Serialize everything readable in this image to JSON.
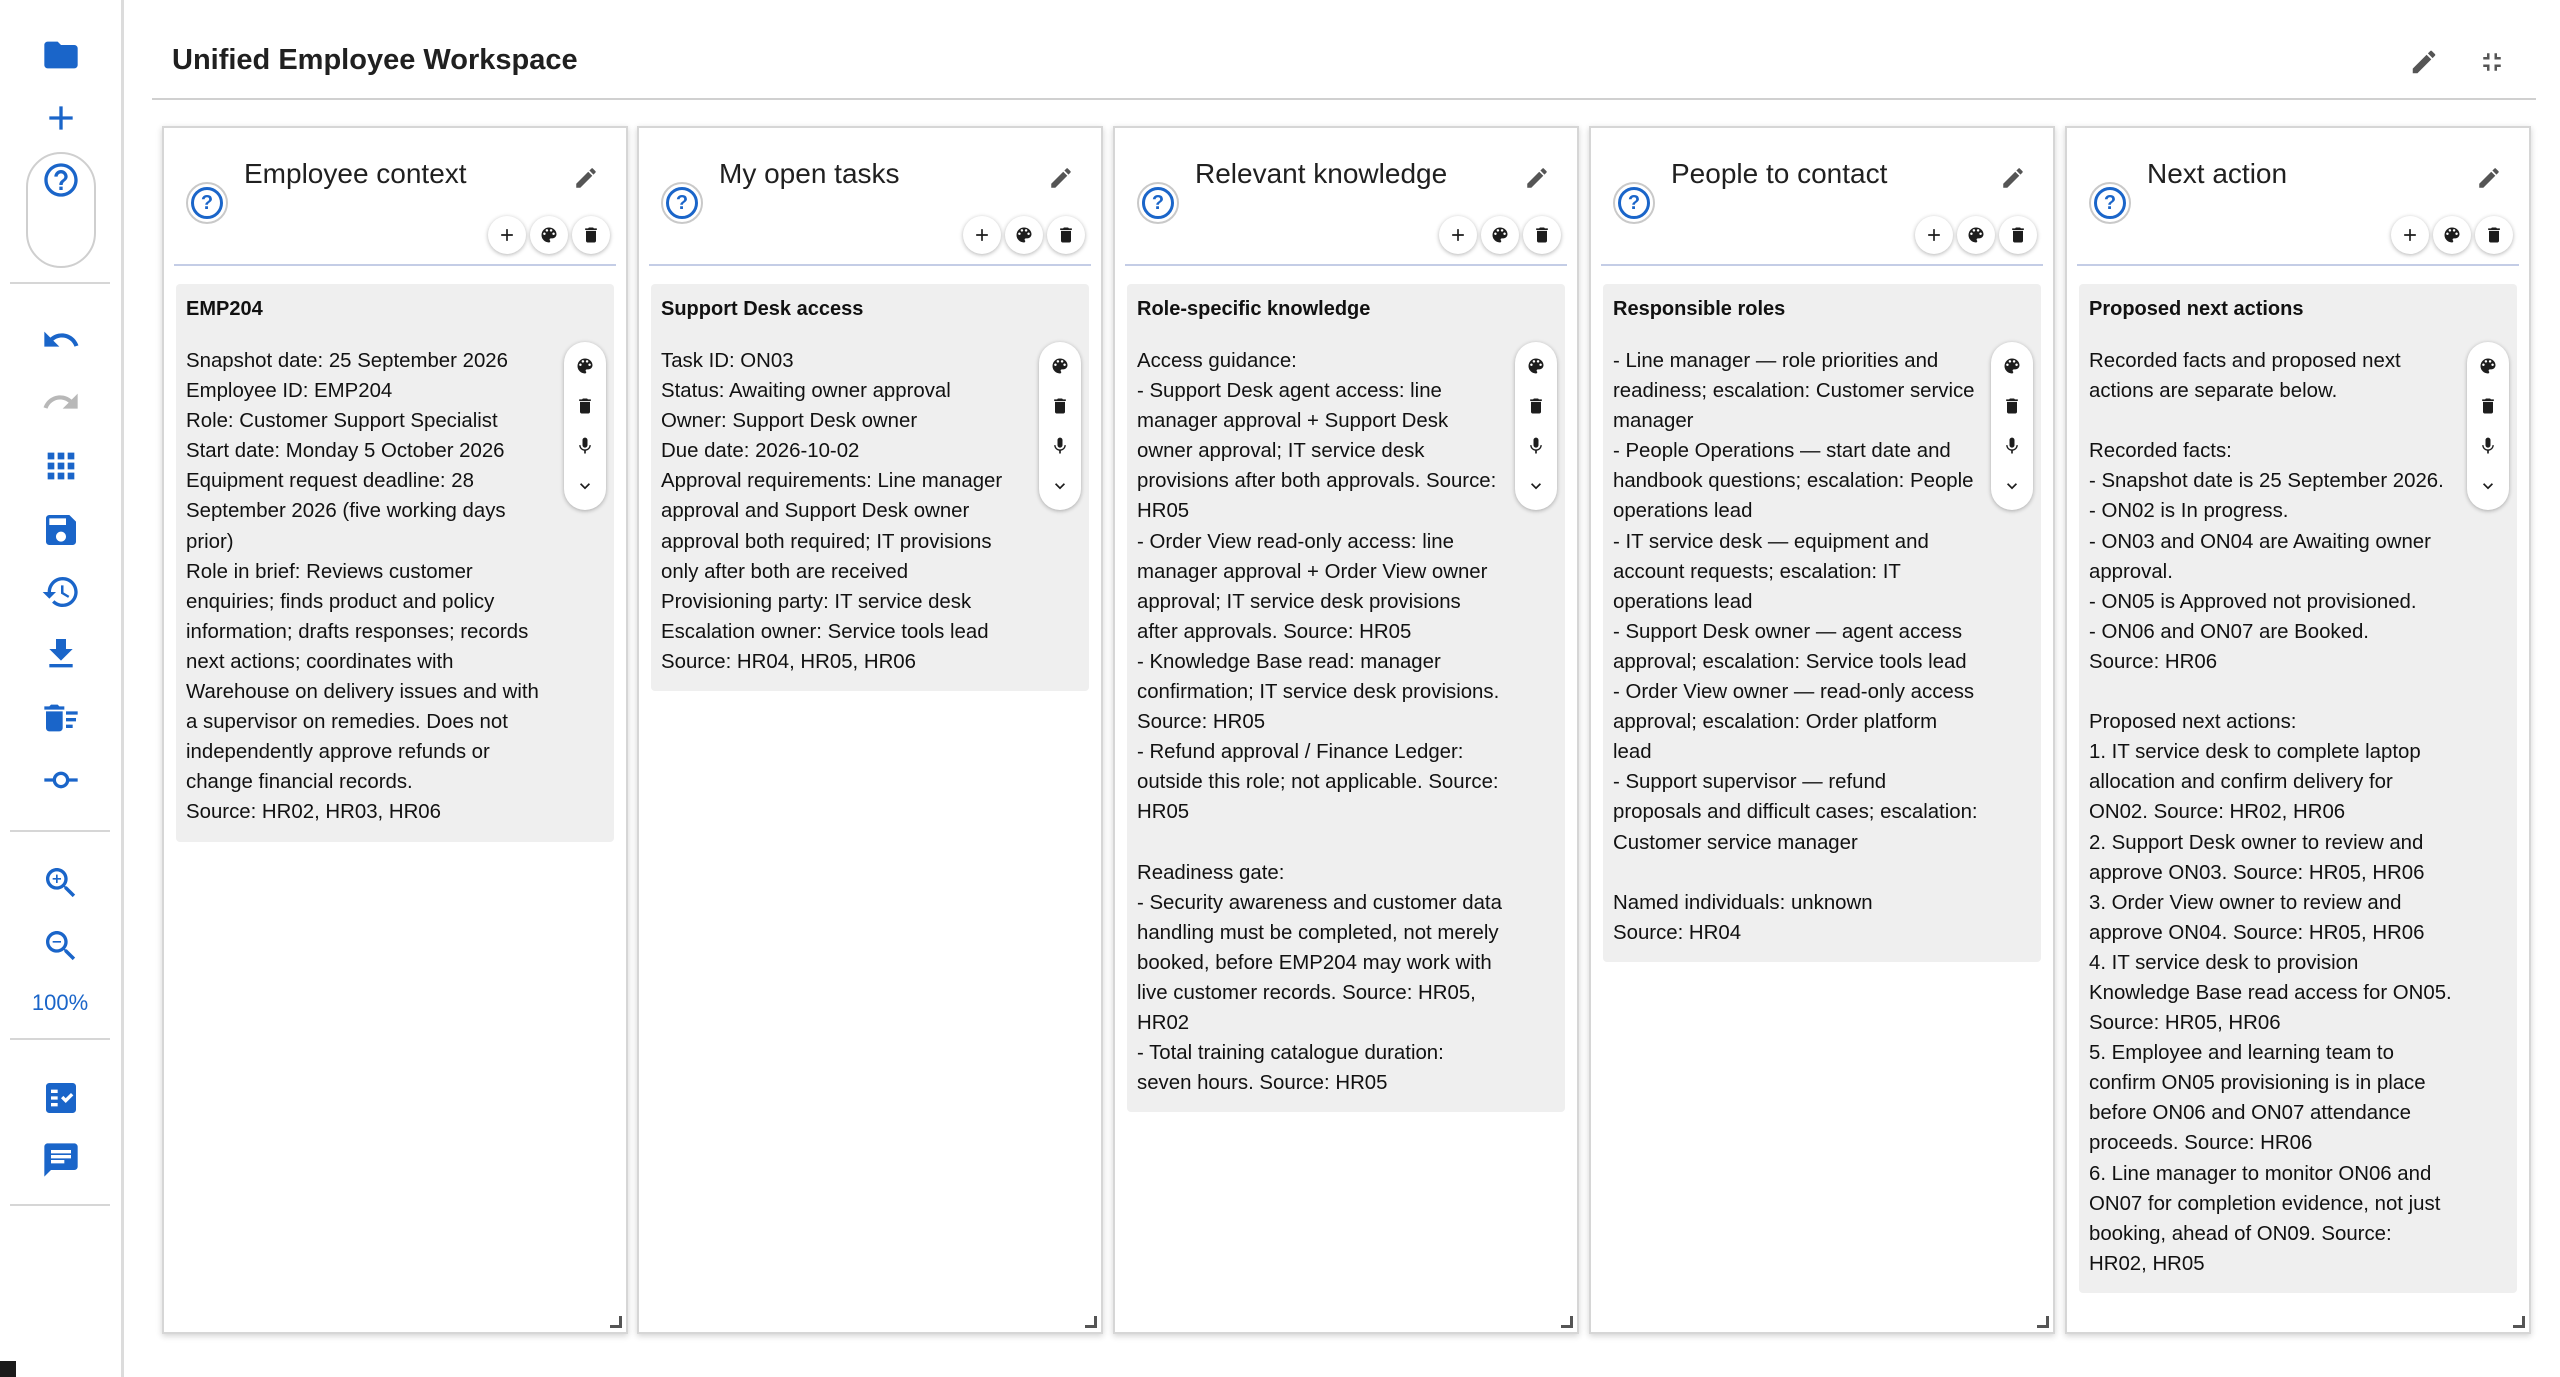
{
  "workspace": {
    "title": "Unified Employee Workspace",
    "edit_icon": "pencil-icon",
    "collapse_icon": "collapse-icon"
  },
  "toolbar": {
    "zoom_label": "100%",
    "icons": [
      "folder-icon",
      "plus-icon",
      "help-icon",
      "undo-icon",
      "redo-icon",
      "grid-icon",
      "save-icon",
      "history-icon",
      "download-icon",
      "delete-list-icon",
      "commit-icon",
      "zoom-in-icon",
      "zoom-out-icon",
      "checklist-icon",
      "chat-icon"
    ]
  },
  "panels": [
    {
      "title": "Employee context",
      "card_title": "EMP204",
      "card_body": "Snapshot date: 25 September 2026\nEmployee ID: EMP204\nRole: Customer Support Specialist\nStart date: Monday 5 October 2026\nEquipment request deadline: 28 September 2026 (five working days prior)\nRole in brief: Reviews customer enquiries; finds product and policy information; drafts responses; records next actions; coordinates with Warehouse on delivery issues and with a supervisor on remedies. Does not independently approve refunds or change financial records.\nSource: HR02, HR03, HR06"
    },
    {
      "title": "My open tasks",
      "card_title": "Support Desk access",
      "card_body": "Task ID: ON03\nStatus: Awaiting owner approval\nOwner: Support Desk owner\nDue date: 2026-10-02\nApproval requirements: Line manager approval and Support Desk owner approval both required; IT provisions only after both are received\nProvisioning party: IT service desk\nEscalation owner: Service tools lead\nSource: HR04, HR05, HR06"
    },
    {
      "title": "Relevant knowledge",
      "card_title": "Role-specific knowledge",
      "card_body": "Access guidance:\n- Support Desk agent access: line manager approval + Support Desk owner approval; IT service desk provisions after both approvals. Source: HR05\n- Order View read-only access: line manager approval + Order View owner approval; IT service desk provisions after approvals. Source: HR05\n- Knowledge Base read: manager confirmation; IT service desk provisions. Source: HR05\n- Refund approval / Finance Ledger: outside this role; not applicable. Source: HR05\n\nReadiness gate:\n- Security awareness and customer data handling must be completed, not merely booked, before EMP204 may work with live customer records. Source: HR05, HR02\n- Total training catalogue duration: seven hours. Source: HR05"
    },
    {
      "title": "People to contact",
      "card_title": "Responsible roles",
      "card_body": "- Line manager — role priorities and readiness; escalation: Customer service manager\n- People Operations — start date and handbook questions; escalation: People operations lead\n- IT service desk — equipment and account requests; escalation: IT operations lead\n- Support Desk owner — agent access approval; escalation: Service tools lead\n- Order View owner — read-only access approval; escalation: Order platform lead\n- Support supervisor — refund proposals and difficult cases; escalation: Customer service manager\n\nNamed individuals: unknown\nSource: HR04"
    },
    {
      "title": "Next action",
      "card_title": "Proposed next actions",
      "card_body": "Recorded facts and proposed next actions are separate below.\n\nRecorded facts:\n- Snapshot date is 25 September 2026.\n- ON02 is In progress.\n- ON03 and ON04 are Awaiting owner approval.\n- ON05 is Approved not provisioned.\n- ON06 and ON07 are Booked.\nSource: HR06\n\nProposed next actions:\n1. IT service desk to complete laptop allocation and confirm delivery for ON02. Source: HR02, HR06\n2. Support Desk owner to review and approve ON03. Source: HR05, HR06\n3. Order View owner to review and approve ON04. Source: HR05, HR06\n4. IT service desk to provision Knowledge Base read access for ON05. Source: HR05, HR06\n5. Employee and learning team to confirm ON05 provisioning is in place before ON06 and ON07 attendance proceeds. Source: HR06\n6. Line manager to monitor ON06 and ON07 for completion evidence, not just booking, ahead of ON09. Source: HR02, HR05"
    }
  ],
  "panel_tools": [
    "add-icon",
    "palette-icon",
    "delete-icon"
  ],
  "card_tools": [
    "palette-icon",
    "delete-icon",
    "microphone-icon",
    "chevron-down-icon"
  ],
  "help_glyph": "?"
}
